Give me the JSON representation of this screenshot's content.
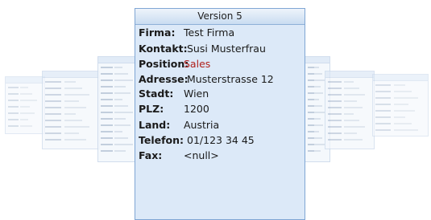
{
  "card": {
    "title": "Version 5",
    "fields": [
      {
        "label": "Firma:",
        "value": "Test Firma"
      },
      {
        "label": "Kontakt:",
        "value": "Susi Musterfrau"
      },
      {
        "label": "Position:",
        "value": "Sales"
      },
      {
        "label": "Adresse:",
        "value": "Musterstrasse 12"
      },
      {
        "label": "Stadt:",
        "value": "Wien"
      },
      {
        "label": "PLZ:",
        "value": "1200"
      },
      {
        "label": "Land:",
        "value": "Austria"
      },
      {
        "label": "Telefon:",
        "value": "01/123 34 45"
      },
      {
        "label": "Fax:",
        "value": "<null>"
      }
    ]
  },
  "colors": {
    "accent_value": "#b0201b",
    "card_background": "#dce9f8",
    "card_border": "#7fa6d4"
  }
}
